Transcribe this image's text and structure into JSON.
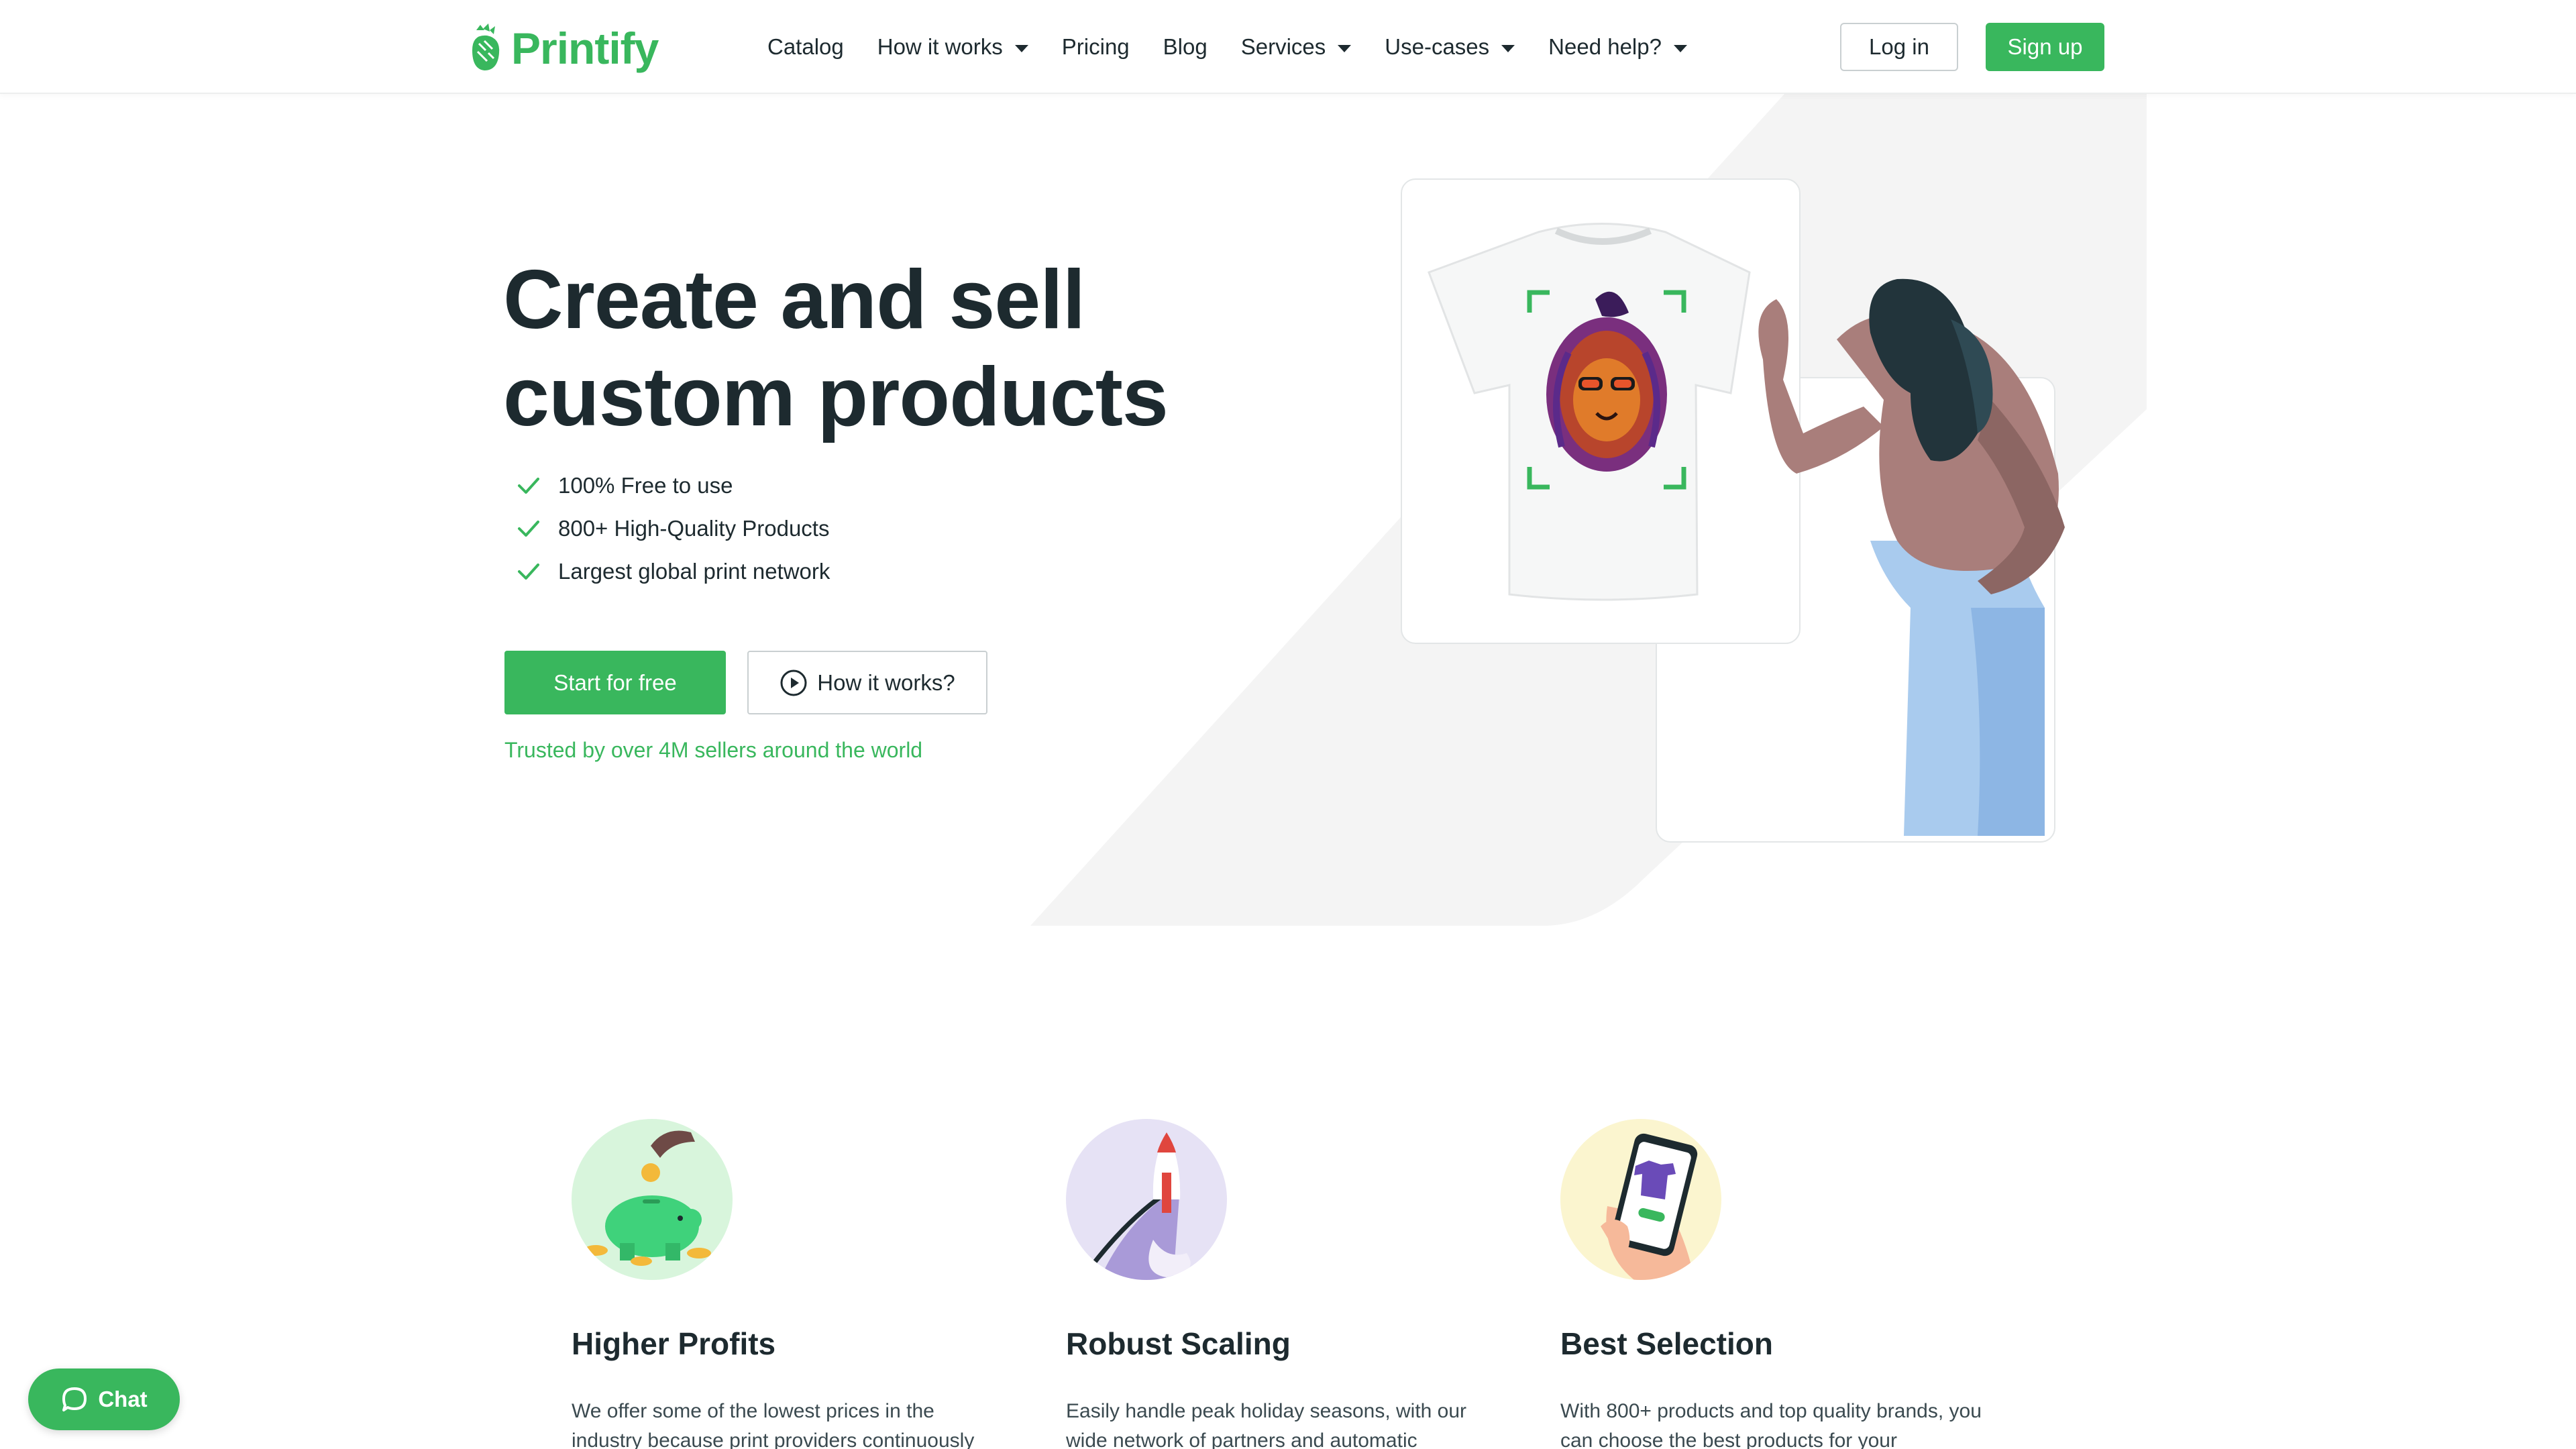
{
  "brand": {
    "name": "Printify",
    "accent": "#39b75d",
    "text": "#1d2a2f"
  },
  "nav": {
    "items": [
      {
        "label": "Catalog",
        "dropdown": false
      },
      {
        "label": "How it works",
        "dropdown": true
      },
      {
        "label": "Pricing",
        "dropdown": false
      },
      {
        "label": "Blog",
        "dropdown": false
      },
      {
        "label": "Services",
        "dropdown": true
      },
      {
        "label": "Use-cases",
        "dropdown": true
      },
      {
        "label": "Need help?",
        "dropdown": true
      }
    ],
    "login_label": "Log in",
    "signup_label": "Sign up"
  },
  "hero": {
    "title_line1": "Create and sell",
    "title_line2": "custom products",
    "features": [
      "100% Free to use",
      "800+ High-Quality Products",
      "Largest global print network"
    ],
    "start_label": "Start for free",
    "how_label": "How it works?",
    "trusted": "Trusted by over 4M sellers around the world"
  },
  "benefits": [
    {
      "title": "Higher Profits",
      "text": "We offer some of the lowest prices in the industry because print providers continuously",
      "icon": "piggy-bank-icon",
      "bg": "#d8f5dc"
    },
    {
      "title": "Robust Scaling",
      "text": "Easily handle peak holiday seasons, with our wide network of partners and automatic",
      "icon": "rocket-icon",
      "bg": "#e6e2f5"
    },
    {
      "title": "Best Selection",
      "text": "With 800+ products and top quality brands, you can choose the best products for your",
      "icon": "phone-in-hand-icon",
      "bg": "#fbf5cf"
    }
  ],
  "chat": {
    "label": "Chat"
  }
}
